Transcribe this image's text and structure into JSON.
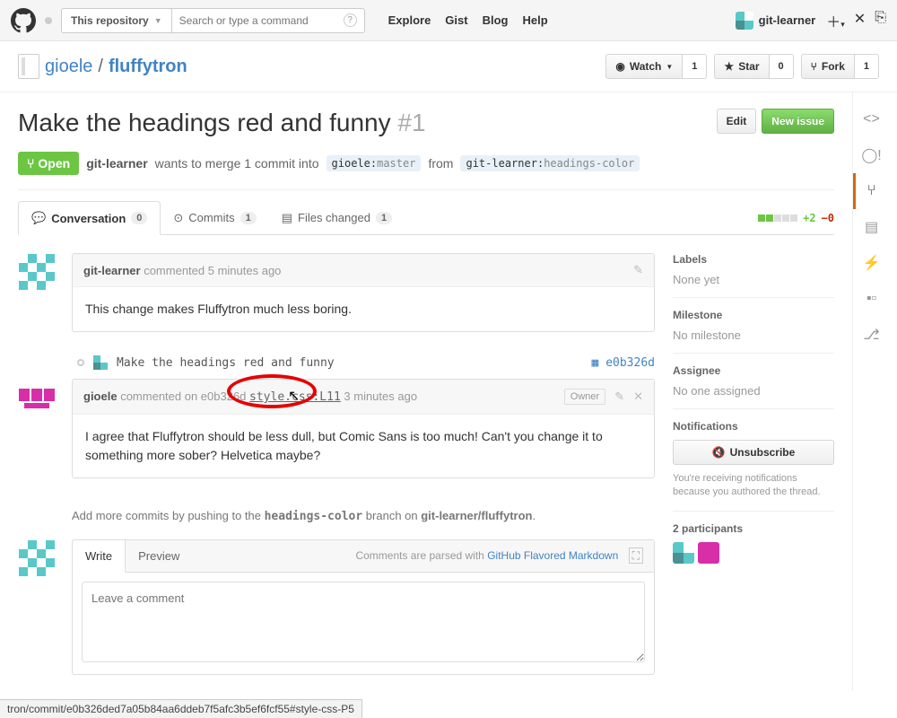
{
  "top": {
    "scope": "This repository",
    "search_placeholder": "Search or type a command",
    "nav": [
      "Explore",
      "Gist",
      "Blog",
      "Help"
    ],
    "user": "git-learner"
  },
  "repo": {
    "owner": "gioele",
    "name": "fluffytron"
  },
  "actions": {
    "watch": {
      "label": "Watch",
      "count": "1"
    },
    "star": {
      "label": "Star",
      "count": "0"
    },
    "fork": {
      "label": "Fork",
      "count": "1"
    }
  },
  "issue": {
    "title": "Make the headings red and funny",
    "number": "#1",
    "edit": "Edit",
    "new": "New issue",
    "state": "Open",
    "author": "git-learner",
    "summary": "wants to merge 1 commit into",
    "base": "gioele",
    "base_branch": "master",
    "from": "from",
    "head": "git-learner",
    "head_branch": "headings-color"
  },
  "tabs": {
    "conversation": "Conversation",
    "conv_count": "0",
    "commits": "Commits",
    "commits_count": "1",
    "files": "Files changed",
    "files_count": "1",
    "plus": "+2",
    "minus": "−0"
  },
  "comments": [
    {
      "author": "git-learner",
      "meta": "commented 5 minutes ago",
      "body": "This change makes Fluffytron much less boring."
    },
    {
      "author": "gioele",
      "meta_pre": "commented on e0b326d ",
      "file": "style.css:L11",
      "meta_post": " 3 minutes ago",
      "owner": "Owner",
      "body": "I agree that Fluffytron should be less dull, but Comic Sans is too much! Can't you change it to something more sober? Helvetica maybe?"
    }
  ],
  "commit": {
    "msg": "Make the headings red and funny",
    "sha": "e0b326d"
  },
  "push": {
    "pre": "Add more commits by pushing to the ",
    "branch": "headings-color",
    "mid": " branch on ",
    "repo": "git-learner/fluffytron",
    "end": "."
  },
  "compose": {
    "write": "Write",
    "preview": "Preview",
    "hint_pre": "Comments are parsed with ",
    "hint_link": "GitHub Flavored Markdown",
    "placeholder": "Leave a comment"
  },
  "sidebar": {
    "labels": {
      "h": "Labels",
      "v": "None yet"
    },
    "milestone": {
      "h": "Milestone",
      "v": "No milestone"
    },
    "assignee": {
      "h": "Assignee",
      "v": "No one assigned"
    },
    "notif": {
      "h": "Notifications",
      "btn": "Unsubscribe",
      "note": "You're receiving notifications because you authored the thread."
    },
    "part": {
      "h": "2 participants"
    }
  },
  "status_url": "tron/commit/e0b326ded7a05b84aa6ddeb7f5afc3b5ef6fcf55#style-css-P5"
}
